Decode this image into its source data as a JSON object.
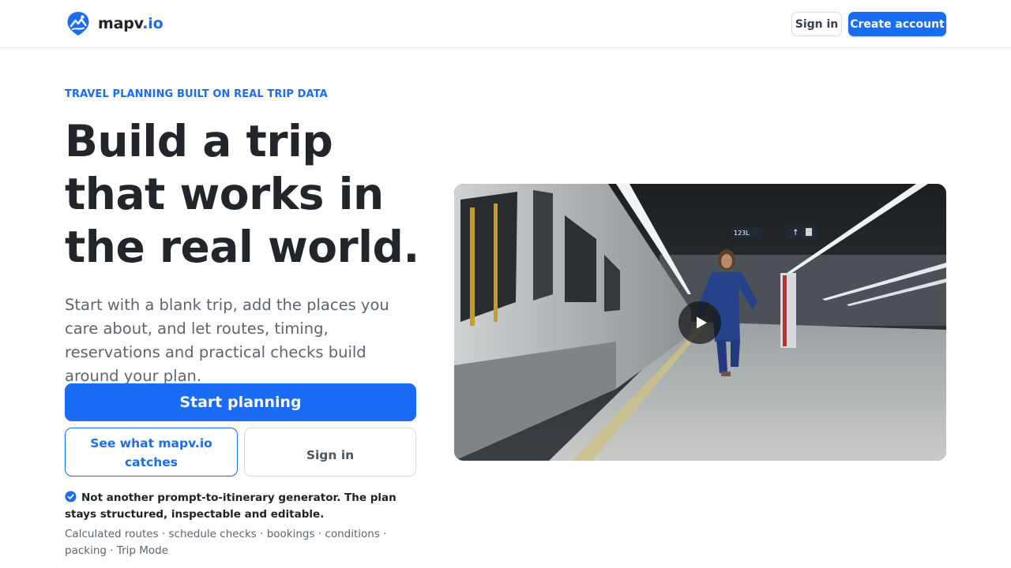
{
  "header": {
    "logo": {
      "name": "mapv",
      "accent": ".io",
      "icon": "map-pin-mountain-icon"
    },
    "signin_label": "Sign in",
    "create_label": "Create account"
  },
  "hero": {
    "eyebrow": "TRAVEL PLANNING BUILT ON REAL TRIP DATA",
    "headline": "Build a trip that works in the real world.",
    "lead": "Start with a blank trip, add the places you care about, and let routes, timing, reservations and practical checks build around your plan.",
    "primary_cta": "Start planning",
    "secondary_cta": "See what mapv.io catches",
    "tertiary_cta": "Sign in",
    "note": "Not another prompt-to-itinerary generator. The plan stays structured, inspectable and editable.",
    "features": "Calculated routes · schedule checks · bookings · conditions · packing · Trip Mode"
  },
  "video": {
    "signs": [
      "123L"
    ],
    "play_icon": "play-icon"
  },
  "colors": {
    "accent": "#1a6cf5",
    "text": "#22262b",
    "muted": "#5c6570",
    "border": "#d7dbe0"
  }
}
